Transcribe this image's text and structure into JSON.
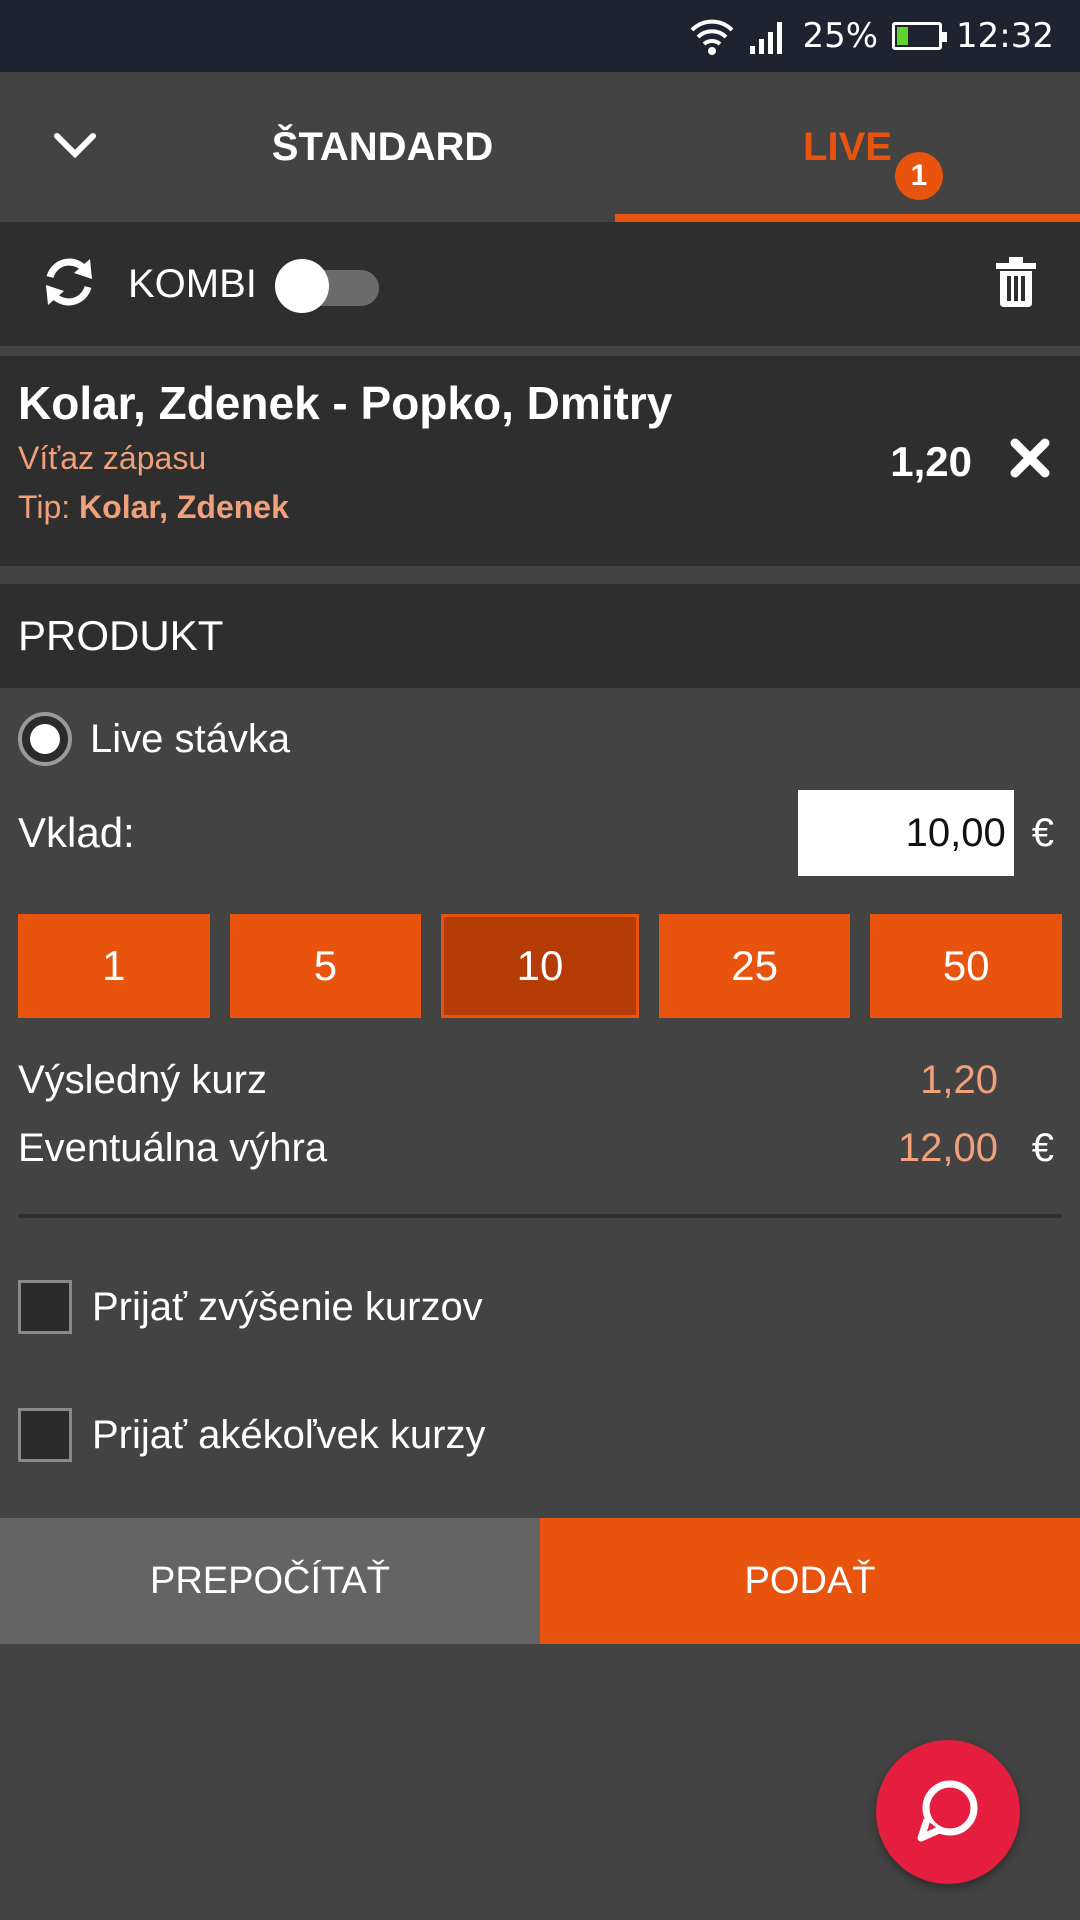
{
  "status_bar": {
    "battery_percent": "25%",
    "time": "12:32",
    "battery_level": 0.25
  },
  "tabs": {
    "standard_label": "ŠTANDARD",
    "live_label": "LIVE",
    "live_badge": "1"
  },
  "toolbar": {
    "kombi_label": "KOMBI",
    "kombi_enabled": false
  },
  "bet": {
    "match": "Kolar, Zdenek - Popko, Dmitry",
    "market": "Víťaz zápasu",
    "tip_label": "Tip: ",
    "tip_value": "Kolar, Zdenek",
    "odd": "1,20"
  },
  "product": {
    "section_title": "PRODUKT",
    "option_label": "Live stávka",
    "stake_label": "Vklad:",
    "stake_value": "10,00",
    "currency": "€",
    "quick_stakes": [
      "1",
      "5",
      "10",
      "25",
      "50"
    ],
    "selected_quick_stake": "10"
  },
  "summary": {
    "total_odds_label": "Výsledný kurz",
    "total_odds_value": "1,20",
    "potential_win_label": "Eventuálna výhra",
    "potential_win_value": "12,00",
    "currency": "€"
  },
  "options": {
    "accept_increase_label": "Prijať zvýšenie kurzov",
    "accept_any_label": "Prijať akékoľvek kurzy"
  },
  "actions": {
    "recalculate_label": "PREPOČÍTAŤ",
    "submit_label": "PODAŤ"
  },
  "colors": {
    "accent": "#e8530e",
    "accent_dark": "#b53c06",
    "secondary_text": "#f0a07a",
    "chat_button": "#e51e3f"
  },
  "icons": {
    "collapse": "chevron-down-icon",
    "refresh": "refresh-icon",
    "trash": "trash-icon",
    "remove": "close-icon",
    "chat": "chat-bubble-icon"
  }
}
